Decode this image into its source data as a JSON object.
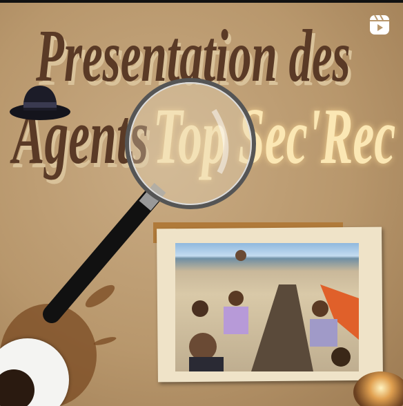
{
  "post": {
    "title_line1": "Presentation des",
    "title_line2_a": "Agents",
    "title_line2_b": "Top Sec'Rec",
    "media_type_icon": "reels-icon",
    "photo_description_icon": "group-photo-beach"
  },
  "colors": {
    "title_brown": "#5a3a26",
    "title_highlight": "#fbe7b4",
    "paper": "#b8976c"
  }
}
